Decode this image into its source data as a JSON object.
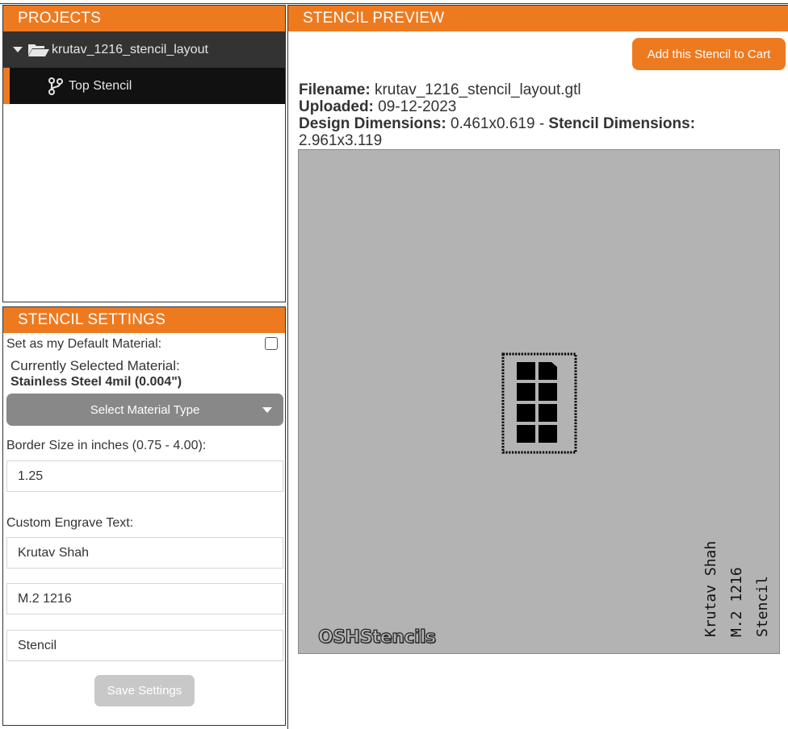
{
  "projects": {
    "header": "PROJECTS",
    "folder_name": "krutav_1216_stencil_layout",
    "child_name": "Top Stencil"
  },
  "settings": {
    "header": "STENCIL SETTINGS",
    "default_label": "Set as my Default Material:",
    "current_label": "Currently Selected Material:",
    "current_value": "Stainless Steel 4mil (0.004\")",
    "select_label": "Select Material Type",
    "border_label": "Border Size in inches (0.75 - 4.00):",
    "border_value": "1.25",
    "engrave_label": "Custom Engrave Text:",
    "engrave_line1": "Krutav Shah",
    "engrave_line2": "M.2 1216",
    "engrave_line3": "Stencil",
    "save_label": "Save Settings"
  },
  "preview": {
    "header": "STENCIL PREVIEW",
    "cart_label": "Add this Stencil to Cart",
    "filename_label": "Filename:",
    "filename_value": "krutav_1216_stencil_layout.gtl",
    "uploaded_label": "Uploaded:",
    "uploaded_value": "09-12-2023",
    "design_label": "Design Dimensions:",
    "design_value": "0.461x0.619",
    "separator": "-",
    "stencil_label": "Stencil Dimensions:",
    "stencil_value": "2.961x3.119",
    "logo_text": "OSHStencils",
    "engrave_lines": [
      "Krutav Shah",
      "M.2 1216",
      "Stencil"
    ]
  },
  "colors": {
    "accent": "#ee7a20",
    "stencil_bg": "#b3b3b3",
    "tree_folder_bg": "#333333",
    "tree_child_bg": "#111111"
  },
  "icons": {
    "folder": "folder-open-icon",
    "branch": "code-branch-icon",
    "caret": "caret-down-icon",
    "dropdown": "dropdown-arrow-icon"
  }
}
